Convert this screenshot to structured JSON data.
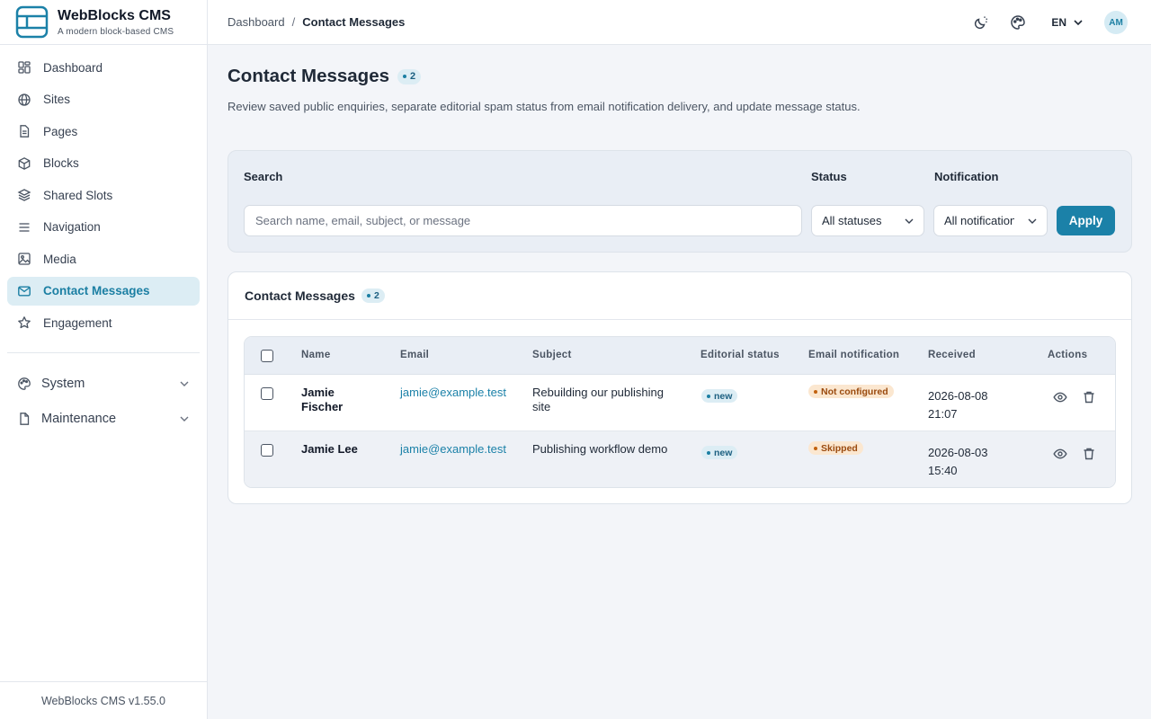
{
  "brand": {
    "title": "WebBlocks CMS",
    "subtitle": "A modern block-based CMS"
  },
  "sidebar": {
    "items": [
      {
        "label": "Dashboard",
        "icon": "dashboard-icon",
        "active": false
      },
      {
        "label": "Sites",
        "icon": "globe-icon",
        "active": false
      },
      {
        "label": "Pages",
        "icon": "document-icon",
        "active": false
      },
      {
        "label": "Blocks",
        "icon": "cube-icon",
        "active": false
      },
      {
        "label": "Shared Slots",
        "icon": "layers-icon",
        "active": false
      },
      {
        "label": "Navigation",
        "icon": "menu-icon",
        "active": false
      },
      {
        "label": "Media",
        "icon": "image-icon",
        "active": false
      },
      {
        "label": "Contact Messages",
        "icon": "mail-icon",
        "active": true
      },
      {
        "label": "Engagement",
        "icon": "star-icon",
        "active": false
      }
    ],
    "groups": [
      {
        "label": "System",
        "icon": "palette-icon"
      },
      {
        "label": "Maintenance",
        "icon": "file-icon"
      }
    ],
    "footer": "WebBlocks CMS v1.55.0"
  },
  "header": {
    "breadcrumb_root": "Dashboard",
    "breadcrumb_sep": "/",
    "breadcrumb_current": "Contact Messages",
    "language": "EN",
    "avatar_initials": "AM"
  },
  "page": {
    "title": "Contact Messages",
    "count": "2",
    "description": "Review saved public enquiries, separate editorial spam status from email notification delivery, and update message status."
  },
  "filters": {
    "search_label": "Search",
    "search_placeholder": "Search name, email, subject, or message",
    "status_label": "Status",
    "status_value": "All statuses",
    "notification_label": "Notification",
    "notification_value": "All notifications",
    "apply_label": "Apply"
  },
  "table": {
    "title": "Contact Messages",
    "count": "2",
    "columns": {
      "name": "Name",
      "email": "Email",
      "subject": "Subject",
      "editorial": "Editorial status",
      "notification": "Email notification",
      "received": "Received",
      "actions": "Actions"
    },
    "rows": [
      {
        "name": "Jamie Fischer",
        "email": "jamie@example.test",
        "subject": "Rebuilding our publishing site",
        "editorial_status": "new",
        "notification": "Not configured",
        "received_date": "2026-08-08",
        "received_time": "21:07"
      },
      {
        "name": "Jamie Lee",
        "email": "jamie@example.test",
        "subject": "Publishing workflow demo",
        "editorial_status": "new",
        "notification": "Skipped",
        "received_date": "2026-08-03",
        "received_time": "15:40"
      }
    ]
  },
  "colors": {
    "accent": "#1b81a8",
    "active_bg": "#dcedf4",
    "warning_bg": "#fbe7d0",
    "warning_text": "#9a4a0e"
  }
}
